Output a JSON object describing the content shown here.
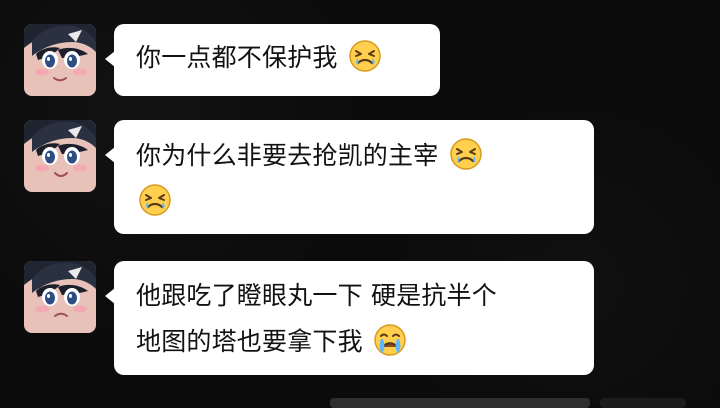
{
  "messages": [
    {
      "avatar": "anime-avatar",
      "lines": [
        {
          "text": "你一点都不保护我",
          "emoji": "crying-face-icon"
        }
      ]
    },
    {
      "avatar": "anime-avatar",
      "lines": [
        {
          "text": "你为什么非要去抢凯的主宰",
          "emoji": "crying-face-icon"
        },
        {
          "text": "",
          "emoji": "crying-face-icon"
        }
      ]
    },
    {
      "avatar": "anime-avatar",
      "lines": [
        {
          "text": "他跟吃了瞪眼丸一下 硬是抗半个",
          "emoji": ""
        },
        {
          "text": "地图的塔也要拿下我",
          "emoji": "loudly-crying-face-icon"
        }
      ]
    }
  ],
  "colors": {
    "background": "#0b0b0b",
    "bubble": "#ffffff",
    "text": "#121212",
    "emoji_yellow": "#ffcf4d",
    "emoji_outline": "#d59b1f",
    "emoji_tear": "#5cb8ff"
  }
}
